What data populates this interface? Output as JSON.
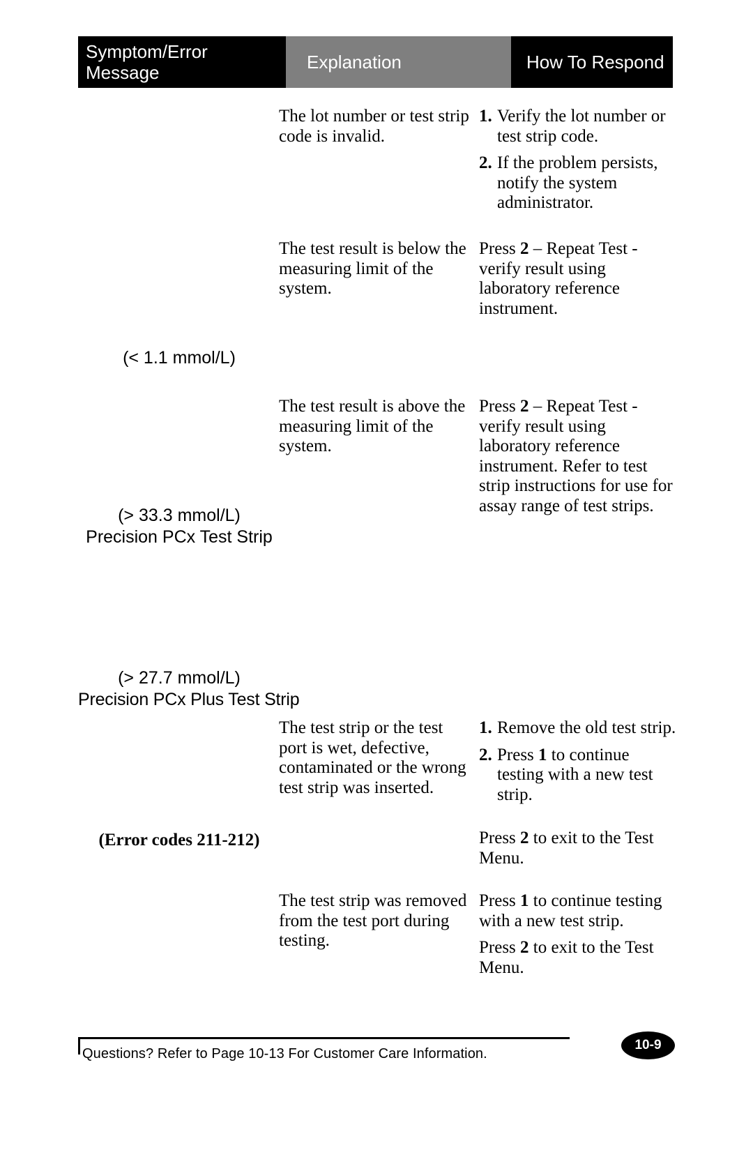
{
  "header": {
    "col1_line1": "Symptom/Error",
    "col1_line2": "Message",
    "col2": "Explanation",
    "col3": "How To Respond"
  },
  "rows": [
    {
      "symptom": "",
      "explanation": "The lot number or test strip code is invalid.",
      "respond_items": [
        {
          "num": "1.",
          "text": "Verify the lot number or test strip code."
        },
        {
          "num": "2.",
          "text": "If the problem persists, notify the system administrator."
        }
      ]
    },
    {
      "symptom": "(< 1.1 mmol/L)",
      "explanation": "The test result is below the measuring limit of the system.",
      "respond_pre": "Press ",
      "respond_key": "2",
      "respond_post": " – Repeat Test - verify result using laboratory reference instrument."
    },
    {
      "symptom_line1": "(> 33.3 mmol/L)",
      "symptom_line2": "Precision PCx Test Strip",
      "symptom_line3": "(> 27.7 mmol/L)",
      "symptom_line4": "Precision PCx Plus Test Strip",
      "explanation": "The test result is above the measuring limit of the system.",
      "respond_pre": "Press ",
      "respond_key": "2",
      "respond_post": " – Repeat Test - verify result using laboratory reference instrument. Refer to test strip instructions for use for assay range of test strips."
    },
    {
      "symptom": "(Error codes 211-212)",
      "explanation": "The test strip or the test port is wet, defective, contaminated or the wrong test strip was inserted.",
      "respond_items": [
        {
          "num": "1.",
          "pre": "Remove the old test strip."
        },
        {
          "num": "2.",
          "pre": "Press ",
          "key": "1",
          "post": " to continue testing with a new test strip."
        }
      ],
      "respond_trailing_pre": "Press ",
      "respond_trailing_key": "2",
      "respond_trailing_post": " to exit to the Test Menu."
    },
    {
      "symptom": "",
      "explanation": "The test strip was removed from the test port during testing.",
      "respond_line1_pre": "Press ",
      "respond_line1_key": "1",
      "respond_line1_post": " to continue testing with a new test strip.",
      "respond_line2_pre": "Press ",
      "respond_line2_key": "2",
      "respond_line2_post": " to exit to the Test Menu."
    }
  ],
  "footer": {
    "note": "Questions? Refer to Page 10-13 For Customer Care Information.",
    "page_number": "10-9"
  },
  "colors": {
    "header_dark": "#000000",
    "header_gray": "#7f7f7f",
    "text": "#000000",
    "background": "#ffffff"
  }
}
